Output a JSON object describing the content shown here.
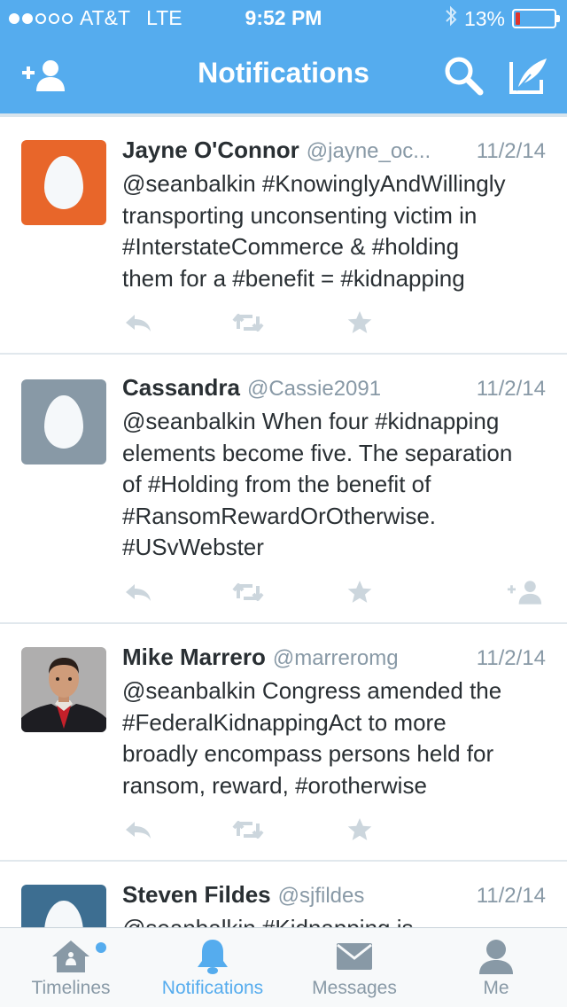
{
  "status": {
    "carrier": "AT&T",
    "network": "LTE",
    "time": "9:52 PM",
    "battery": "13%",
    "battery_level": 0.13,
    "battery_color": "#e0342c",
    "signal_dots_filled": 2,
    "signal_dots_total": 5
  },
  "nav": {
    "title": "Notifications",
    "left_icon": "add-user-icon",
    "right_icons": [
      "search-icon",
      "compose-icon"
    ]
  },
  "colors": {
    "brand": "#55acee",
    "text": "#292f33",
    "secondary": "#8899a6",
    "action": "#ccd6dd"
  },
  "tweets": [
    {
      "name": "Jayne O'Connor",
      "handle": "@jayne_oc...",
      "date": "11/2/14",
      "lines": [
        "@seanbalkin #KnowinglyAndWillingly",
        "transporting unconsenting victim in",
        "#InterstateCommerce & #holding",
        "them for a #benefit = #kidnapping"
      ],
      "avatar": "egg-avatar",
      "avatar_color": "#e8662a"
    },
    {
      "name": "Cassandra",
      "handle": "@Cassie2091",
      "date": "11/2/14",
      "lines": [
        "@seanbalkin When four #kidnapping",
        "elements become five. The separation",
        "of #Holding from the benefit of",
        "#RansomRewardOrOtherwise.",
        "#USvWebster"
      ],
      "avatar": "egg-avatar",
      "avatar_color": "#8899a6"
    },
    {
      "name": "Mike Marrero",
      "handle": "@marreromg",
      "date": "11/2/14",
      "lines": [
        "@seanbalkin Congress amended the",
        "#FederalKidnappingAct to more",
        "broadly encompass persons held for",
        "ransom, reward, #orotherwise"
      ],
      "avatar": "profile-photo"
    },
    {
      "name": "Steven Fildes",
      "handle": "@sjfildes",
      "date": "11/2/14",
      "lines": [
        "@seanbalkin #Kidnapping is"
      ],
      "avatar": "egg-avatar",
      "avatar_color": "#3d6e91"
    }
  ],
  "tabs": [
    {
      "label": "Timelines",
      "icon": "home-icon",
      "active": false,
      "has_new_dot": true
    },
    {
      "label": "Notifications",
      "icon": "bell-icon",
      "active": true
    },
    {
      "label": "Messages",
      "icon": "envelope-icon",
      "active": false
    },
    {
      "label": "Me",
      "icon": "person-icon",
      "active": false
    }
  ]
}
